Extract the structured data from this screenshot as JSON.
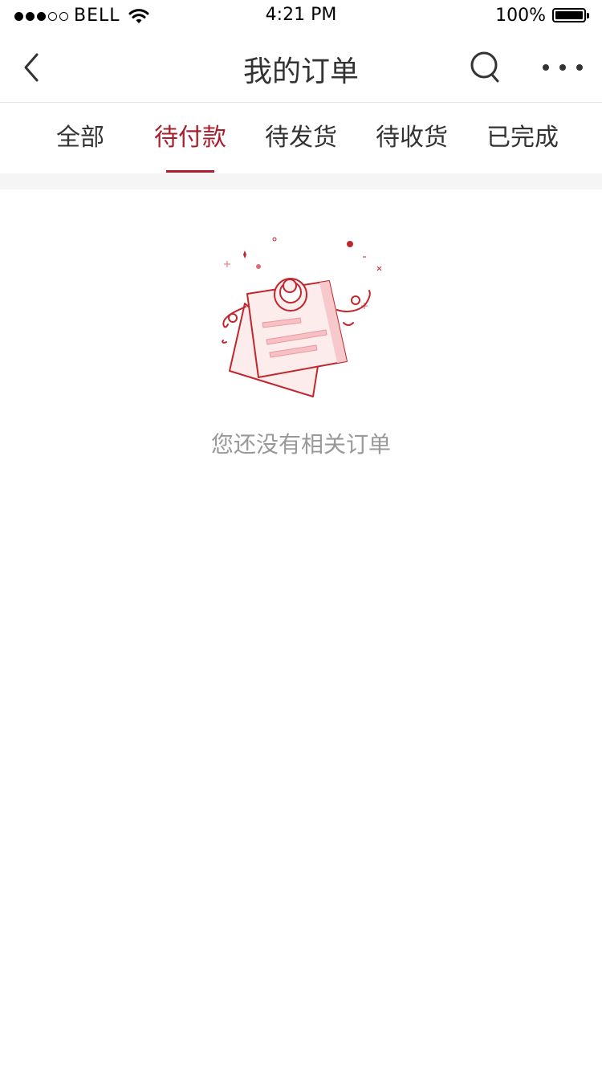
{
  "status_bar": {
    "carrier": "BELL",
    "time": "4:21 PM",
    "battery": "100%",
    "signal_icon": "signal-dots-icon",
    "wifi_icon": "wifi-icon",
    "battery_icon": "battery-icon"
  },
  "nav": {
    "title": "我的订单",
    "back_icon": "chevron-left-icon",
    "search_icon": "search-icon",
    "more_icon": "more-dots-icon"
  },
  "tabs": [
    {
      "label": "全部"
    },
    {
      "label": "待付款"
    },
    {
      "label": "待发货"
    },
    {
      "label": "待收货"
    },
    {
      "label": "已完成"
    }
  ],
  "active_tab": "待付款",
  "empty_state": {
    "icon": "empty-order-note-icon",
    "message": "您还没有相关订单"
  },
  "colors": {
    "accent": "#a81e2d",
    "text": "#333333",
    "muted": "#999999",
    "divider": "#f5f5f5"
  }
}
